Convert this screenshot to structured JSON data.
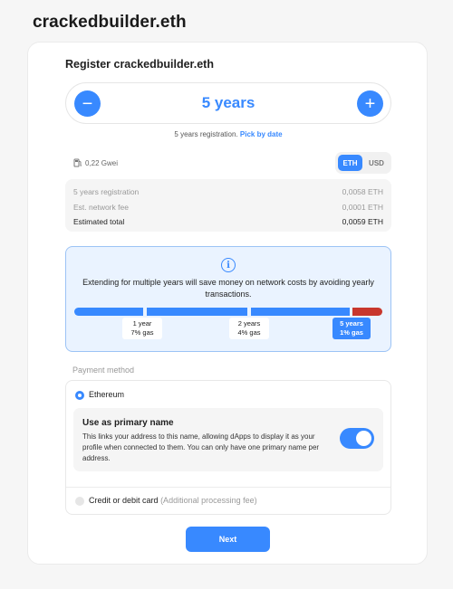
{
  "site": {
    "title": "crackedbuilder.eth"
  },
  "card": {
    "title": "Register crackedbuilder.eth",
    "stepper": {
      "minus_symbol": "−",
      "plus_symbol": "+",
      "value_label": "5 years"
    },
    "registration_note": {
      "text": "5 years registration. ",
      "link": "Pick by date"
    }
  },
  "gas": {
    "label": "0,22 Gwei",
    "icon": "gas-pump-icon"
  },
  "currency_toggle": {
    "options": [
      "ETH",
      "USD"
    ],
    "selected": "ETH"
  },
  "fees": [
    {
      "label": "5 years registration",
      "value": "0,0058 ETH"
    },
    {
      "label": "Est. network fee",
      "value": "0,0001 ETH"
    },
    {
      "label": "Estimated total",
      "value": "0,0059 ETH"
    }
  ],
  "info": {
    "icon": "info-icon",
    "icon_glyph": "i",
    "text": "Extending for multiple years will save money on network costs by avoiding yearly transactions.",
    "ticks": [
      {
        "years": "1 year",
        "gas": "7% gas"
      },
      {
        "years": "2 years",
        "gas": "4% gas"
      },
      {
        "years": "5 years",
        "gas": "1% gas"
      }
    ],
    "selected_tick": "5 years"
  },
  "payment": {
    "label": "Payment method",
    "options": [
      {
        "label": "Ethereum",
        "selected": true
      },
      {
        "label": "Credit or debit card",
        "note": "(Additional processing fee)",
        "selected": false
      }
    ],
    "primary_name": {
      "title": "Use as primary name",
      "description": "This links your address to this name, allowing dApps to display it as your profile when connected to them. You can only have one primary name per address.",
      "enabled": true
    }
  },
  "next_button": "Next",
  "colors": {
    "accent": "#3889ff",
    "warning": "#c8372d",
    "info_bg": "#eaf3ff"
  }
}
